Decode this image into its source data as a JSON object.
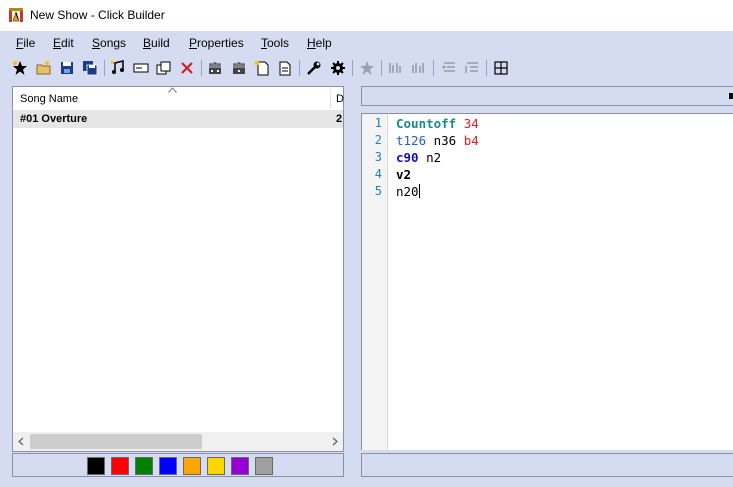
{
  "window": {
    "title": "New Show - Click Builder"
  },
  "menu": [
    {
      "label": "File",
      "accel": "F",
      "rest": "ile"
    },
    {
      "label": "Edit",
      "accel": "E",
      "rest": "dit"
    },
    {
      "label": "Songs",
      "accel": "S",
      "rest": "ongs"
    },
    {
      "label": "Build",
      "accel": "B",
      "rest": "uild"
    },
    {
      "label": "Properties",
      "accel": "P",
      "rest": "roperties"
    },
    {
      "label": "Tools",
      "accel": "T",
      "rest": "ools"
    },
    {
      "label": "Help",
      "accel": "H",
      "rest": "elp"
    }
  ],
  "toolbar": {
    "icons": [
      "new-show-star-icon",
      "open-folder-icon",
      "save-icon",
      "save-all-icon",
      "add-song-icon",
      "rename-icon",
      "duplicate-icon",
      "delete-icon",
      "build-icon",
      "build-all-icon",
      "new-doc-icon",
      "properties-doc-icon",
      "wrench-icon",
      "gear-icon",
      "favorite-star-icon",
      "track-a-icon",
      "track-b-icon",
      "list-a-icon",
      "list-b-icon",
      "grid-icon"
    ]
  },
  "song_list": {
    "columns": [
      "Song Name",
      "D"
    ],
    "rows": [
      {
        "name": "#01 Overture",
        "d": "2"
      }
    ]
  },
  "color_swatches": [
    "#000000",
    "#ff0000",
    "#008000",
    "#0000ff",
    "#ffa500",
    "#ffd700",
    "#9400d3",
    "#a0a0a0"
  ],
  "editor": {
    "lines": [
      {
        "num": "1",
        "tokens": [
          {
            "t": "Countoff",
            "c": "tok-green"
          },
          {
            "t": " ",
            "c": "tok-plain"
          },
          {
            "t": "34",
            "c": "tok-red"
          }
        ]
      },
      {
        "num": "2",
        "tokens": [
          {
            "t": "t126",
            "c": "tok-blue"
          },
          {
            "t": " n36 ",
            "c": "tok-plain"
          },
          {
            "t": "b4",
            "c": "tok-red"
          }
        ]
      },
      {
        "num": "3",
        "tokens": [
          {
            "t": "c90",
            "c": "tok-bold-blue"
          },
          {
            "t": " n2",
            "c": "tok-plain"
          }
        ]
      },
      {
        "num": "4",
        "tokens": [
          {
            "t": "v2",
            "c": "tok-bold"
          }
        ]
      },
      {
        "num": "5",
        "tokens": [
          {
            "t": "n20",
            "c": "tok-plain"
          }
        ]
      }
    ]
  }
}
